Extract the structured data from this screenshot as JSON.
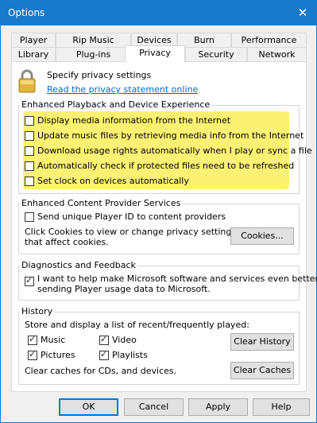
{
  "window": {
    "title": "Options"
  },
  "tabs": {
    "row1": [
      "Player",
      "Rip Music",
      "Devices",
      "Burn",
      "Performance"
    ],
    "row2": [
      "Library",
      "Plug-ins",
      "Privacy",
      "Security",
      "Network"
    ],
    "active": "Privacy"
  },
  "header": {
    "text": "Specify privacy settings",
    "link": "Read the privacy statement online"
  },
  "playback": {
    "title": "Enhanced Playback and Device Experience",
    "items": [
      {
        "label": "Display media information from the Internet",
        "checked": false
      },
      {
        "label": "Update music files by retrieving media info from the Internet",
        "checked": false
      },
      {
        "label": "Download usage rights automatically when I play or sync a file",
        "checked": false
      },
      {
        "label": "Automatically check if protected files need to be refreshed",
        "checked": false
      },
      {
        "label": "Set clock on devices automatically",
        "checked": false
      }
    ],
    "highlight_color": "#fbee5a"
  },
  "provider": {
    "title": "Enhanced Content Provider Services",
    "send_id_label": "Send unique Player ID to content providers",
    "cookies_text_line1": "Click Cookies to view or change privacy settings",
    "cookies_text_line2": "that affect cookies.",
    "cookies_button": "Cookies..."
  },
  "diagnostics": {
    "title": "Diagnostics and Feedback",
    "line1": "I want to help make Microsoft software and services even better by",
    "line2": "sending Player usage data to Microsoft.",
    "checked": true
  },
  "history": {
    "title": "History",
    "description": "Store and display a list of recent/frequently played:",
    "music": "Music",
    "video": "Video",
    "pictures": "Pictures",
    "playlists": "Playlists",
    "clear_history_button": "Clear History",
    "clear_caches_text": "Clear caches for CDs, and devices.",
    "clear_caches_button": "Clear Caches"
  },
  "footer": {
    "ok": "OK",
    "cancel": "Cancel",
    "apply": "Apply",
    "help": "Help"
  },
  "colors": {
    "titlebar": "#1979ca",
    "link": "#0066cc",
    "default_button_border": "#0078d7"
  }
}
